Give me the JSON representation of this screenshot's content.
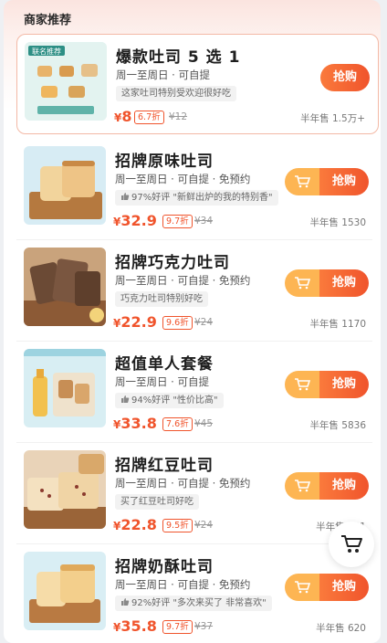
{
  "header": {
    "title": "商家推荐"
  },
  "items": [
    {
      "title": "爆款吐司 5 选 1",
      "availability": "周一至周日 · 可自提",
      "tagline": "这家吐司特别受欢迎很好吃",
      "price_currency": "¥",
      "price": "8",
      "discount": "6.7折",
      "original_price": "¥12",
      "sold": "半年售 1.5万+",
      "buy_label": "抢购",
      "thumb_label": "联名推荐",
      "featured": true
    },
    {
      "title": "招牌原味吐司",
      "availability": "周一至周日 · 可自提 · 免预约",
      "tagline": "97%好评 \"新鲜出炉的我的特别香\"",
      "price_currency": "¥",
      "price": "32.9",
      "discount": "9.7折",
      "original_price": "¥34",
      "sold": "半年售 1530",
      "buy_label": "抢购"
    },
    {
      "title": "招牌巧克力吐司",
      "availability": "周一至周日 · 可自提 · 免预约",
      "tagline": "巧克力吐司特别好吃",
      "price_currency": "¥",
      "price": "22.9",
      "discount": "9.6折",
      "original_price": "¥24",
      "sold": "半年售 1170",
      "buy_label": "抢购"
    },
    {
      "title": "超值单人套餐",
      "availability": "周一至周日 · 可自提",
      "tagline": "94%好评 \"性价比高\"",
      "price_currency": "¥",
      "price": "33.8",
      "discount": "7.6折",
      "original_price": "¥45",
      "sold": "半年售 5836",
      "buy_label": "抢购"
    },
    {
      "title": "招牌红豆吐司",
      "availability": "周一至周日 · 可自提 · 免预约",
      "tagline": "买了红豆吐司好吃",
      "price_currency": "¥",
      "price": "22.8",
      "discount": "9.5折",
      "original_price": "¥24",
      "sold": "半年售 781",
      "buy_label": "抢购"
    },
    {
      "title": "招牌奶酥吐司",
      "availability": "周一至周日 · 可自提 · 免预约",
      "tagline": "92%好评 \"多次来买了 非常喜欢\"",
      "price_currency": "¥",
      "price": "35.8",
      "discount": "9.7折",
      "original_price": "¥37",
      "sold": "半年售 620",
      "buy_label": "抢购"
    }
  ],
  "colors": {
    "accent": "#f0542c",
    "cart_orange": "#fdb553",
    "header_bg": "#fbe4df"
  },
  "icons": {
    "cart": "cart-icon",
    "thumbs_up": "thumbs-up-icon"
  }
}
